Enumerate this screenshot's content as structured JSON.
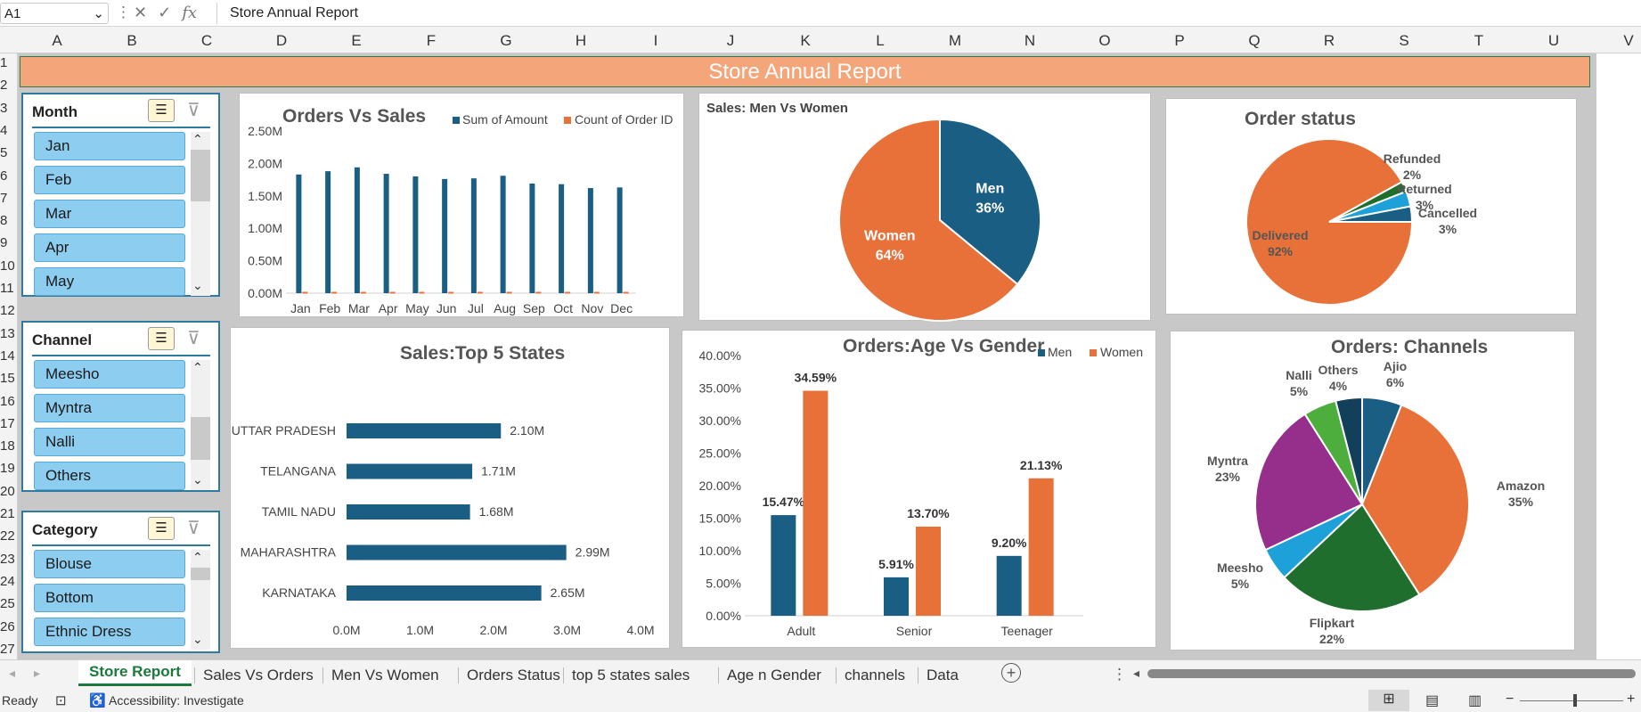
{
  "formula_bar": {
    "name_box": "A1",
    "formula": "Store Annual Report"
  },
  "columns": [
    "A",
    "B",
    "C",
    "D",
    "E",
    "F",
    "G",
    "H",
    "I",
    "J",
    "K",
    "L",
    "M",
    "N",
    "O",
    "P",
    "Q",
    "R",
    "S",
    "T",
    "U",
    "V"
  ],
  "rows": [
    "1",
    "2",
    "3",
    "4",
    "5",
    "6",
    "7",
    "8",
    "9",
    "10",
    "11",
    "12",
    "13",
    "14",
    "15",
    "16",
    "17",
    "18",
    "19",
    "20",
    "21",
    "22",
    "23",
    "24",
    "25",
    "26",
    "27"
  ],
  "banner": "Store Annual Report",
  "slicers": [
    {
      "title": "Month",
      "items": [
        "Jan",
        "Feb",
        "Mar",
        "Apr",
        "May"
      ]
    },
    {
      "title": "Channel",
      "items": [
        "Meesho",
        "Myntra",
        "Nalli",
        "Others"
      ]
    },
    {
      "title": "Category",
      "items": [
        "Blouse",
        "Bottom",
        "Ethnic Dress"
      ]
    }
  ],
  "chart_data": [
    {
      "type": "bar",
      "title": "Orders Vs Sales",
      "categories": [
        "Jan",
        "Feb",
        "Mar",
        "Apr",
        "May",
        "Jun",
        "Jul",
        "Aug",
        "Sep",
        "Oct",
        "Nov",
        "Dec"
      ],
      "series": [
        {
          "name": "Sum of Amount",
          "values": [
            1830000,
            1880000,
            1940000,
            1840000,
            1800000,
            1760000,
            1770000,
            1810000,
            1690000,
            1680000,
            1620000,
            1630000
          ],
          "color": "#1b5e84"
        },
        {
          "name": "Count of Order ID",
          "values": [
            2800,
            2900,
            3000,
            2850,
            2800,
            2750,
            2750,
            2800,
            2650,
            2600,
            2500,
            2550
          ],
          "color": "#e8713a"
        }
      ],
      "yticks": [
        "0.00M",
        "0.50M",
        "1.00M",
        "1.50M",
        "2.00M",
        "2.50M"
      ],
      "ylim": [
        0,
        2500000
      ]
    },
    {
      "type": "pie",
      "title": "Sales: Men Vs Women",
      "labels": [
        "Men",
        "Women"
      ],
      "values": [
        36,
        64
      ],
      "display": [
        "36%",
        "64%"
      ],
      "colors": [
        "#1b5e84",
        "#e8713a"
      ]
    },
    {
      "type": "pie",
      "title": "Order status",
      "labels": [
        "Delivered",
        "Refunded",
        "Returned",
        "Cancelled"
      ],
      "values": [
        92,
        2,
        3,
        3
      ],
      "display": [
        "92%",
        "2%",
        "3%",
        "3%"
      ],
      "colors": [
        "#e8713a",
        "#1f6e2e",
        "#1ea0d8",
        "#1b5e84"
      ]
    },
    {
      "type": "bar",
      "title": "Sales:Top 5 States",
      "categories": [
        "UTTAR PRADESH",
        "TELANGANA",
        "TAMIL NADU",
        "MAHARASHTRA",
        "KARNATAKA"
      ],
      "values": [
        2.1,
        1.71,
        1.68,
        2.99,
        2.65
      ],
      "display": [
        "2.10M",
        "1.71M",
        "1.68M",
        "2.99M",
        "2.65M"
      ],
      "xticks": [
        "0.0M",
        "1.0M",
        "2.0M",
        "3.0M",
        "4.0M"
      ],
      "xlim": [
        0,
        4
      ],
      "color": "#1b5e84"
    },
    {
      "type": "bar",
      "title": "Orders:Age Vs Gender",
      "categories": [
        "Adult",
        "Senior",
        "Teenager"
      ],
      "series": [
        {
          "name": "Men",
          "values": [
            15.47,
            5.91,
            9.2
          ],
          "display": [
            "15.47%",
            "5.91%",
            "9.20%"
          ],
          "color": "#1b5e84"
        },
        {
          "name": "Women",
          "values": [
            34.59,
            13.7,
            21.13
          ],
          "display": [
            "34.59%",
            "13.70%",
            "21.13%"
          ],
          "color": "#e8713a"
        }
      ],
      "yticks": [
        "0.00%",
        "5.00%",
        "10.00%",
        "15.00%",
        "20.00%",
        "25.00%",
        "30.00%",
        "35.00%",
        "40.00%"
      ],
      "ylim": [
        0,
        40
      ]
    },
    {
      "type": "pie",
      "title": "Orders: Channels",
      "labels": [
        "Ajio",
        "Amazon",
        "Flipkart",
        "Meesho",
        "Myntra",
        "Nalli",
        "Others"
      ],
      "values": [
        6,
        35,
        22,
        5,
        23,
        5,
        4
      ],
      "display": [
        "6%",
        "35%",
        "22%",
        "5%",
        "23%",
        "5%",
        "4%"
      ],
      "colors": [
        "#1b5e84",
        "#e8713a",
        "#1f6e2e",
        "#1ea0d8",
        "#962f8c",
        "#4eae3d",
        "#123f5a"
      ]
    }
  ],
  "sheet_tabs": [
    "Store Report",
    "Sales Vs Orders",
    "Men Vs Women",
    "Orders Status",
    "top 5 states sales",
    "Age n Gender",
    "channels",
    "Data"
  ],
  "status": {
    "ready": "Ready",
    "accessibility": "Accessibility: Investigate"
  }
}
